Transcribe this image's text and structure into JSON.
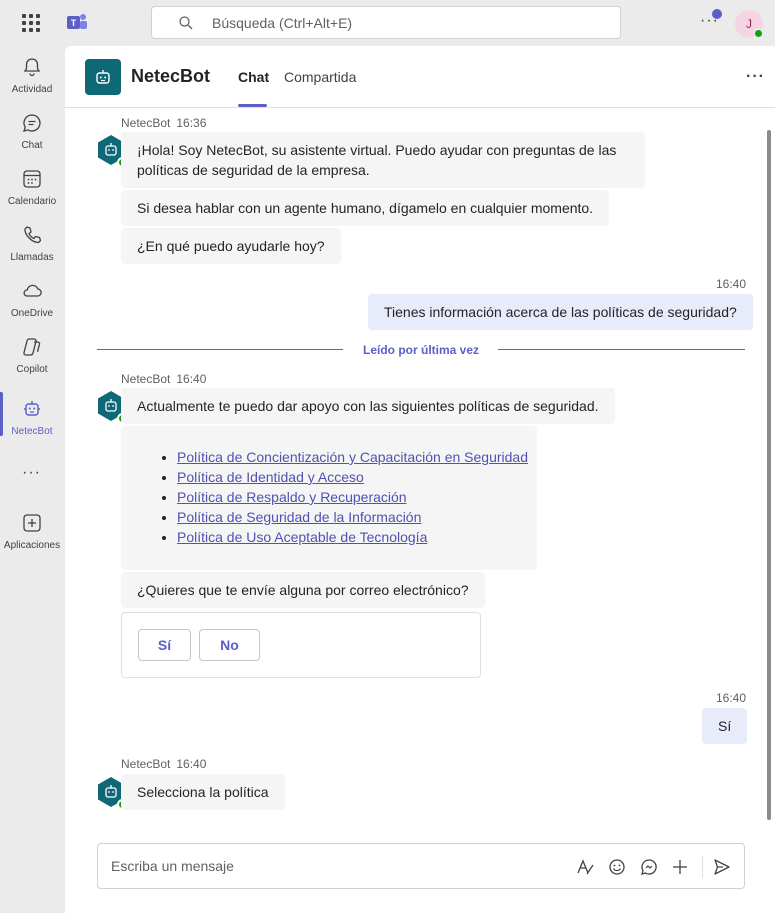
{
  "topbar": {
    "search_placeholder": "Búsqueda (Ctrl+Alt+E)",
    "avatar_initial": "J",
    "accent_color": "#5b5fc7"
  },
  "rail": {
    "items": [
      {
        "label": "Actividad",
        "icon": "bell-icon"
      },
      {
        "label": "Chat",
        "icon": "chat-icon"
      },
      {
        "label": "Calendario",
        "icon": "calendar-icon"
      },
      {
        "label": "Llamadas",
        "icon": "phone-icon"
      },
      {
        "label": "OneDrive",
        "icon": "cloud-icon"
      },
      {
        "label": "Copilot",
        "icon": "copilot-icon"
      },
      {
        "label": "NetecBot",
        "icon": "bot-icon"
      },
      {
        "label": "Aplicaciones",
        "icon": "add-app-icon"
      }
    ]
  },
  "header": {
    "title": "NetecBot",
    "tabs": [
      {
        "label": "Chat",
        "active": true
      },
      {
        "label": "Compartida",
        "active": false
      }
    ]
  },
  "messages": {
    "m1": {
      "sender": "NetecBot",
      "time": "16:36",
      "texts": [
        "¡Hola! Soy NetecBot, su asistente virtual. Puedo ayudar con preguntas de las políticas de seguridad de la empresa.",
        "Si desea hablar con un agente humano, dígamelo en cualquier momento.",
        "¿En qué puedo ayudarle hoy?"
      ]
    },
    "m2": {
      "time": "16:40",
      "text": "Tienes información acerca de las políticas de seguridad?"
    },
    "divider": "Leído por última vez",
    "m3": {
      "sender": "NetecBot",
      "time": "16:40",
      "intro": "Actualmente te puedo dar apoyo con las siguientes políticas de seguridad.",
      "links": [
        "Política de Concientización y Capacitación en Seguridad",
        "Política de Identidad y Acceso",
        "Política de Respaldo y Recuperación",
        "Política de Seguridad de la Información",
        "Política de Uso Aceptable de Tecnología"
      ],
      "question": "¿Quieres que te envíe alguna por correo electrónico?",
      "yes_label": "Sí",
      "no_label": "No"
    },
    "m4": {
      "time": "16:40",
      "text": "Sí"
    },
    "m5": {
      "sender": "NetecBot",
      "time": "16:40",
      "text": "Selecciona la política"
    }
  },
  "compose": {
    "placeholder": "Escriba un mensaje"
  }
}
